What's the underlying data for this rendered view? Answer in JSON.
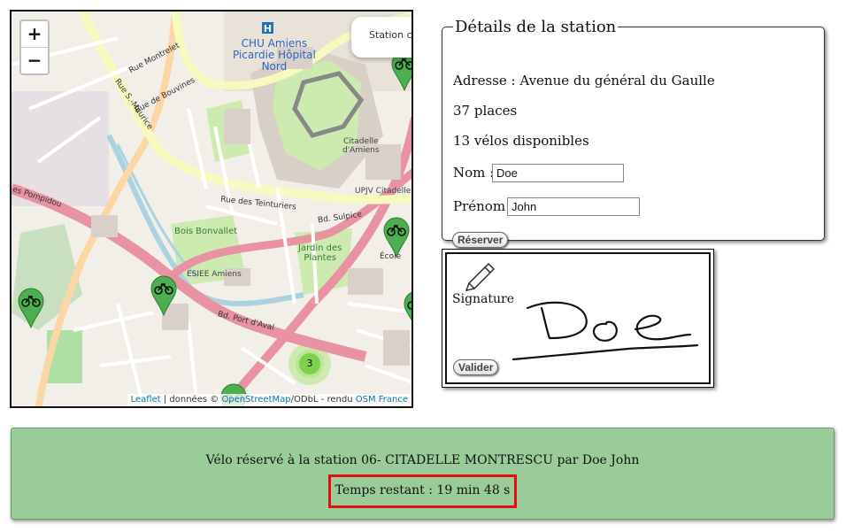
{
  "map": {
    "zoom_in": "+",
    "zoom_out": "−",
    "station_tooltip": "Station ch",
    "cluster_count": "3",
    "attribution": {
      "leaflet": "Leaflet",
      "sep1": " | données © ",
      "osm": "OpenStreetMap",
      "sep2": "/ODbL - rendu ",
      "osm_france": "OSM France"
    },
    "labels": {
      "chu": "CHU Amiens\nPicardie Hôpital\nNord",
      "citadelle": "Citadelle\nd'Amiens",
      "upjv": "UPJV Citadelle",
      "bois": "Bois Bonvallet",
      "jardin": "Jardin des\nPlantes",
      "esiee": "ESIEE Amiens",
      "port": "Bd. Port d'Aval",
      "pompidou": "es Pompidou",
      "sulpice": "Bd. Sulpice",
      "teinturiers": "Rue des Teinturiers",
      "maurice": "Rue S.-Maurice",
      "montrelet": "Rue Montrelet",
      "bouvines": "Rue de Bouvines",
      "ecole": "École"
    }
  },
  "details": {
    "legend": "Détails de la station",
    "address": "Adresse : Avenue du général du Gaulle",
    "places": "37 places",
    "bikes": "13 vélos disponibles",
    "name_label": "Nom :",
    "name_value": "Doe",
    "firstname_label": "Prénom :",
    "firstname_value": "John",
    "reserve_button": "Réserver"
  },
  "signature": {
    "label": "Signature",
    "validate_button": "Valider"
  },
  "status": {
    "message": "Vélo réservé à la station 06- CITADELLE MONTRESCU par Doe John",
    "timer": "Temps restant : 19 min 48 s",
    "colors": {
      "background": "#99cc99",
      "timer_border": "#e01010"
    }
  }
}
